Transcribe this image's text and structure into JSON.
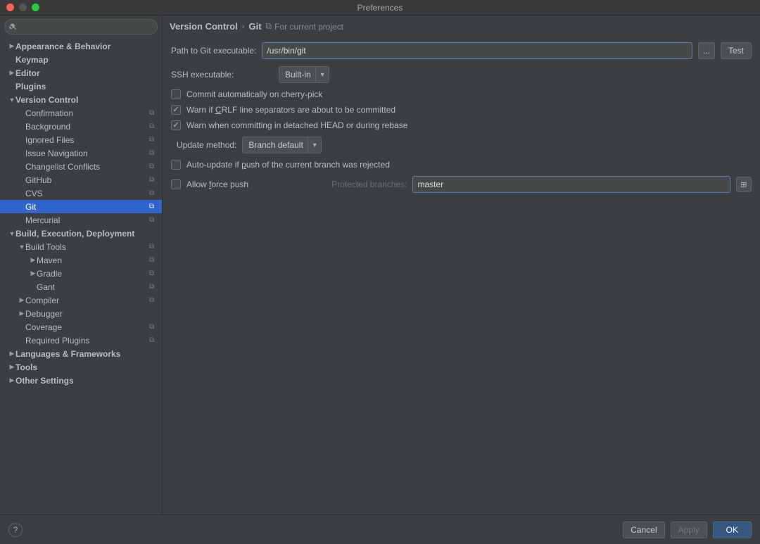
{
  "window": {
    "title": "Preferences"
  },
  "breadcrumb": {
    "parent": "Version Control",
    "current": "Git",
    "hint": "For current project"
  },
  "sidebar": [
    {
      "label": "Appearance & Behavior",
      "depth": 0,
      "bold": true,
      "arrow": "right",
      "scope": false
    },
    {
      "label": "Keymap",
      "depth": 0,
      "bold": true,
      "arrow": "",
      "scope": false
    },
    {
      "label": "Editor",
      "depth": 0,
      "bold": true,
      "arrow": "right",
      "scope": false
    },
    {
      "label": "Plugins",
      "depth": 0,
      "bold": true,
      "arrow": "",
      "scope": false
    },
    {
      "label": "Version Control",
      "depth": 0,
      "bold": true,
      "arrow": "down",
      "scope": false
    },
    {
      "label": "Confirmation",
      "depth": 1,
      "bold": false,
      "arrow": "",
      "scope": true
    },
    {
      "label": "Background",
      "depth": 1,
      "bold": false,
      "arrow": "",
      "scope": true
    },
    {
      "label": "Ignored Files",
      "depth": 1,
      "bold": false,
      "arrow": "",
      "scope": true
    },
    {
      "label": "Issue Navigation",
      "depth": 1,
      "bold": false,
      "arrow": "",
      "scope": true
    },
    {
      "label": "Changelist Conflicts",
      "depth": 1,
      "bold": false,
      "arrow": "",
      "scope": true
    },
    {
      "label": "GitHub",
      "depth": 1,
      "bold": false,
      "arrow": "",
      "scope": true
    },
    {
      "label": "CVS",
      "depth": 1,
      "bold": false,
      "arrow": "",
      "scope": true
    },
    {
      "label": "Git",
      "depth": 1,
      "bold": false,
      "arrow": "",
      "scope": true,
      "selected": true
    },
    {
      "label": "Mercurial",
      "depth": 1,
      "bold": false,
      "arrow": "",
      "scope": true
    },
    {
      "label": "Build, Execution, Deployment",
      "depth": 0,
      "bold": true,
      "arrow": "down",
      "scope": false
    },
    {
      "label": "Build Tools",
      "depth": 1,
      "bold": false,
      "arrow": "down",
      "scope": true
    },
    {
      "label": "Maven",
      "depth": 2,
      "bold": false,
      "arrow": "right",
      "scope": true
    },
    {
      "label": "Gradle",
      "depth": 2,
      "bold": false,
      "arrow": "right",
      "scope": true
    },
    {
      "label": "Gant",
      "depth": 2,
      "bold": false,
      "arrow": "",
      "scope": true
    },
    {
      "label": "Compiler",
      "depth": 1,
      "bold": false,
      "arrow": "right",
      "scope": true
    },
    {
      "label": "Debugger",
      "depth": 1,
      "bold": false,
      "arrow": "right",
      "scope": false
    },
    {
      "label": "Coverage",
      "depth": 1,
      "bold": false,
      "arrow": "",
      "scope": true
    },
    {
      "label": "Required Plugins",
      "depth": 1,
      "bold": false,
      "arrow": "",
      "scope": true
    },
    {
      "label": "Languages & Frameworks",
      "depth": 0,
      "bold": true,
      "arrow": "right",
      "scope": false
    },
    {
      "label": "Tools",
      "depth": 0,
      "bold": true,
      "arrow": "right",
      "scope": false
    },
    {
      "label": "Other Settings",
      "depth": 0,
      "bold": true,
      "arrow": "right",
      "scope": false
    }
  ],
  "form": {
    "path_label": "Path to Git executable:",
    "path_value": "/usr/bin/git",
    "browse_label": "...",
    "test_label": "Test",
    "ssh_label": "SSH executable:",
    "ssh_value": "Built-in",
    "chk_cherry": "Commit automatically on cherry-pick",
    "chk_crlf_pre": "Warn if ",
    "chk_crlf_ul": "C",
    "chk_crlf_post": "RLF line separators are about to be committed",
    "chk_detached": "Warn when committing in detached HEAD or during rebase",
    "update_label": "Update method:",
    "update_value": "Branch default",
    "chk_auto_pre": "Auto-update if ",
    "chk_auto_ul": "p",
    "chk_auto_post": "ush of the current branch was rejected",
    "chk_force_pre": "Allow ",
    "chk_force_ul": "f",
    "chk_force_post": "orce push",
    "protected_label": "Protected branches:",
    "protected_value": "master"
  },
  "footer": {
    "cancel": "Cancel",
    "apply": "Apply",
    "ok": "OK"
  }
}
